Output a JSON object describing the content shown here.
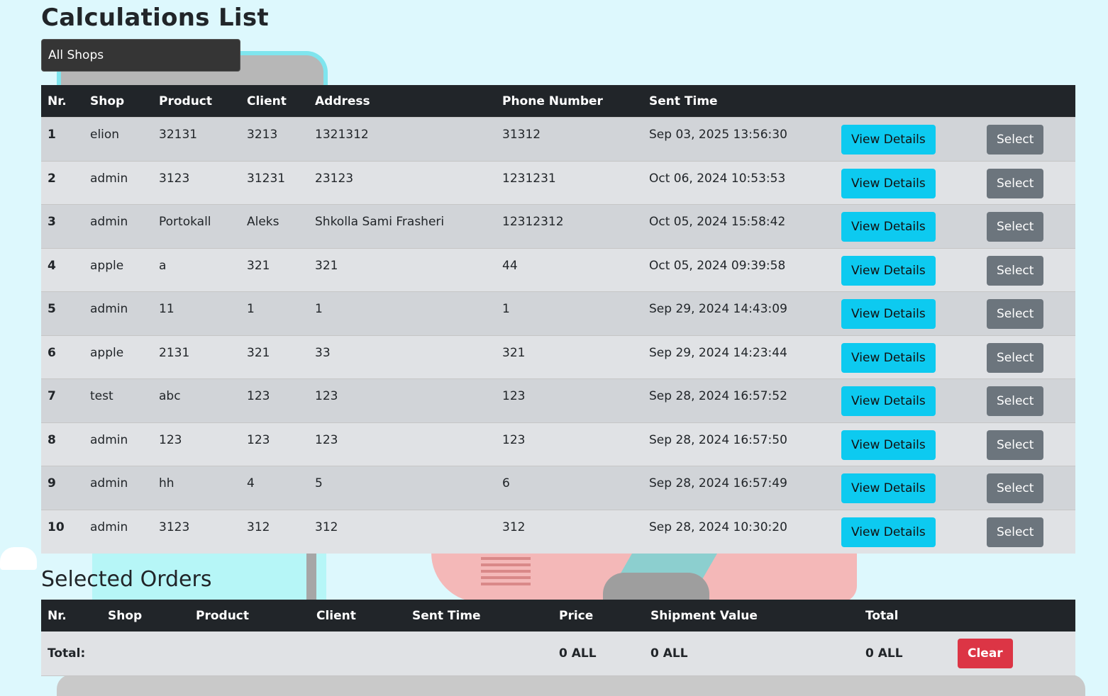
{
  "page": {
    "title": "Calculations List",
    "shop_filter": "All Shops"
  },
  "calc_table": {
    "headers": [
      "Nr.",
      "Shop",
      "Product",
      "Client",
      "Address",
      "Phone Number",
      "Sent Time",
      "",
      ""
    ],
    "view_label": "View Details",
    "select_label": "Select",
    "rows": [
      {
        "nr": "1",
        "shop": "elion",
        "product": "32131",
        "client": "3213",
        "address": "1321312",
        "phone": "31312",
        "sent": "Sep 03, 2025 13:56:30"
      },
      {
        "nr": "2",
        "shop": "admin",
        "product": "3123",
        "client": "31231",
        "address": "23123",
        "phone": "1231231",
        "sent": "Oct 06, 2024 10:53:53"
      },
      {
        "nr": "3",
        "shop": "admin",
        "product": "Portokall",
        "client": "Aleks",
        "address": "Shkolla Sami Frasheri",
        "phone": "12312312",
        "sent": "Oct 05, 2024 15:58:42"
      },
      {
        "nr": "4",
        "shop": "apple",
        "product": "a",
        "client": "321",
        "address": "321",
        "phone": "44",
        "sent": "Oct 05, 2024 09:39:58"
      },
      {
        "nr": "5",
        "shop": "admin",
        "product": "11",
        "client": "1",
        "address": "1",
        "phone": "1",
        "sent": "Sep 29, 2024 14:43:09"
      },
      {
        "nr": "6",
        "shop": "apple",
        "product": "2131",
        "client": "321",
        "address": "33",
        "phone": "321",
        "sent": "Sep 29, 2024 14:23:44"
      },
      {
        "nr": "7",
        "shop": "test",
        "product": "abc",
        "client": "123",
        "address": "123",
        "phone": "123",
        "sent": "Sep 28, 2024 16:57:52"
      },
      {
        "nr": "8",
        "shop": "admin",
        "product": "123",
        "client": "123",
        "address": "123",
        "phone": "123",
        "sent": "Sep 28, 2024 16:57:50"
      },
      {
        "nr": "9",
        "shop": "admin",
        "product": "hh",
        "client": "4",
        "address": "5",
        "phone": "6",
        "sent": "Sep 28, 2024 16:57:49"
      },
      {
        "nr": "10",
        "shop": "admin",
        "product": "3123",
        "client": "312",
        "address": "312",
        "phone": "312",
        "sent": "Sep 28, 2024 10:30:20"
      }
    ]
  },
  "selected": {
    "title": "Selected Orders",
    "headers": [
      "Nr.",
      "Shop",
      "Product",
      "Client",
      "Sent Time",
      "Price",
      "Shipment Value",
      "Total",
      ""
    ],
    "total_label": "Total:",
    "price_total": "0 ALL",
    "shipment_total": "0 ALL",
    "grand_total": "0 ALL",
    "clear_label": "Clear"
  },
  "colors": {
    "info": "#0dcaf0",
    "secondary": "#6c757d",
    "danger": "#dc3545",
    "header": "#212529",
    "background": "#ddf8fd"
  }
}
